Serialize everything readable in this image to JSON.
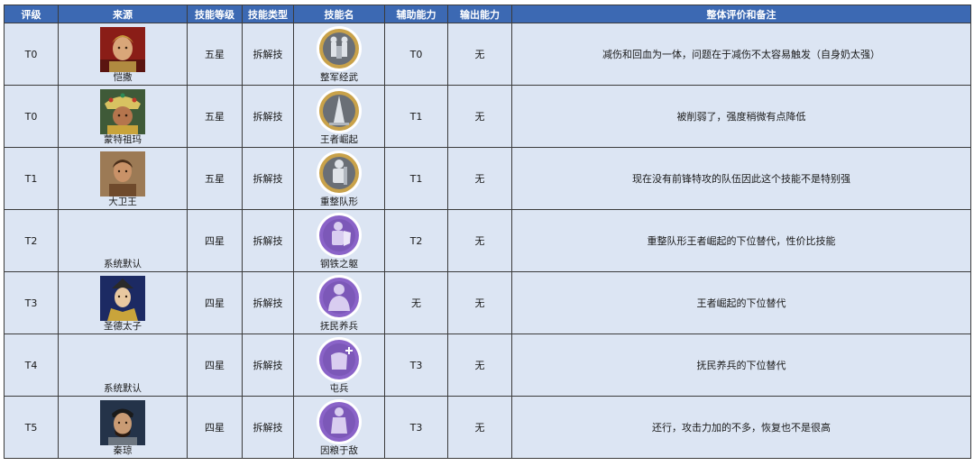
{
  "headers": [
    "评级",
    "来源",
    "技能等级",
    "技能类型",
    "技能名",
    "辅助能力",
    "输出能力",
    "整体评价和备注"
  ],
  "rows": [
    {
      "tier": "T0",
      "source": "恺撒",
      "portrait": "caesar-portrait",
      "level": "五星",
      "type": "拆解技",
      "skill": "整军经武",
      "skill_icon": "knights-icon",
      "skill_theme": "gold",
      "support": "T0",
      "output": "无",
      "note": "减伤和回血为一体，问题在于减伤不太容易触发（自身奶太强）"
    },
    {
      "tier": "T0",
      "source": "蒙特祖玛",
      "portrait": "montezuma-portrait",
      "level": "五星",
      "type": "拆解技",
      "skill": "王者崛起",
      "skill_icon": "tower-icon",
      "skill_theme": "gold",
      "support": "T1",
      "output": "无",
      "note": "被削弱了，强度稍微有点降低"
    },
    {
      "tier": "T1",
      "source": "大卫王",
      "portrait": "king-david-portrait",
      "level": "五星",
      "type": "拆解技",
      "skill": "重整队形",
      "skill_icon": "armored-soldier-icon",
      "skill_theme": "gold",
      "support": "T1",
      "output": "无",
      "note": "现在没有前锋特攻的队伍因此这个技能不是特别强"
    },
    {
      "tier": "T2",
      "source": "系统默认",
      "portrait": "",
      "level": "四星",
      "type": "拆解技",
      "skill": "钢铁之躯",
      "skill_icon": "shield-soldier-icon",
      "skill_theme": "purple",
      "support": "T2",
      "output": "无",
      "note": "重整队形王者崛起的下位替代，性价比技能"
    },
    {
      "tier": "T3",
      "source": "圣德太子",
      "portrait": "prince-shotoku-portrait",
      "level": "四星",
      "type": "拆解技",
      "skill": "抚民养兵",
      "skill_icon": "soldier-bust-icon",
      "skill_theme": "purple",
      "support": "无",
      "output": "无",
      "note": "王者崛起的下位替代"
    },
    {
      "tier": "T4",
      "source": "系统默认",
      "portrait": "",
      "level": "四星",
      "type": "拆解技",
      "skill": "屯兵",
      "skill_icon": "armor-plus-icon",
      "skill_theme": "purple",
      "support": "T3",
      "output": "无",
      "note": "抚民养兵的下位替代"
    },
    {
      "tier": "T5",
      "source": "秦琼",
      "portrait": "qin-qiong-portrait",
      "level": "四星",
      "type": "拆解技",
      "skill": "因粮于敌",
      "skill_icon": "statue-icon",
      "skill_theme": "purple",
      "support": "T3",
      "output": "无",
      "note": "还行，攻击力加的不多，恢复也不是很高"
    }
  ],
  "colors": {
    "header_bg": "#3c69b3",
    "row_bg": "#dce5f3",
    "gold_icon": "#c9a24a",
    "purple_icon": "#8a63c8"
  }
}
